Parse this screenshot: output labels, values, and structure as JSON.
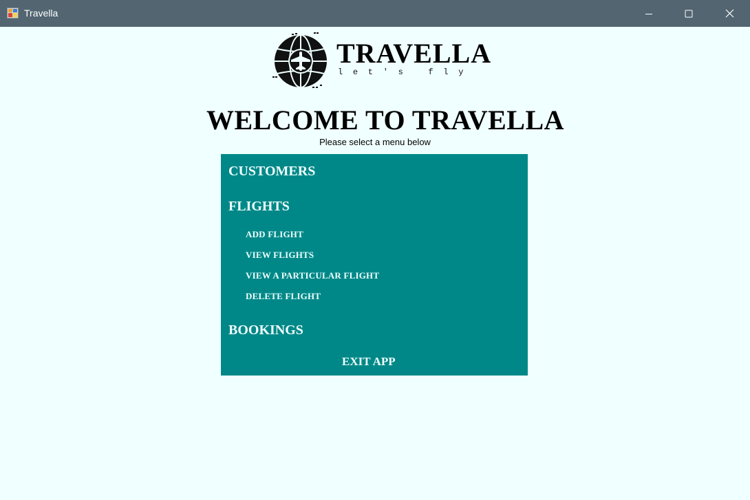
{
  "window": {
    "title": "Travella",
    "app_icon": "form-app-icon",
    "controls": [
      "minimize-icon",
      "maximize-icon",
      "close-icon"
    ]
  },
  "logo": {
    "name": "TRAVELLA",
    "tagline": "let's fly",
    "icon": "globe-airplane-icon"
  },
  "header": {
    "title": "WELCOME TO TRAVELLA",
    "subtitle": "Please select a menu below"
  },
  "menu": {
    "customers": "CUSTOMERS",
    "flights": "FLIGHTS",
    "flight_items": {
      "add": "ADD FLIGHT",
      "view": "VIEW FLIGHTS",
      "view_particular": "VIEW A PARTICULAR FLIGHT",
      "delete": "DELETE FLIGHT"
    },
    "bookings": "BOOKINGS",
    "exit": "EXIT APP"
  },
  "colors": {
    "titlebar": "#526571",
    "background": "#f0ffff",
    "menu_background": "#008888",
    "menu_text": "#f0ffff"
  }
}
